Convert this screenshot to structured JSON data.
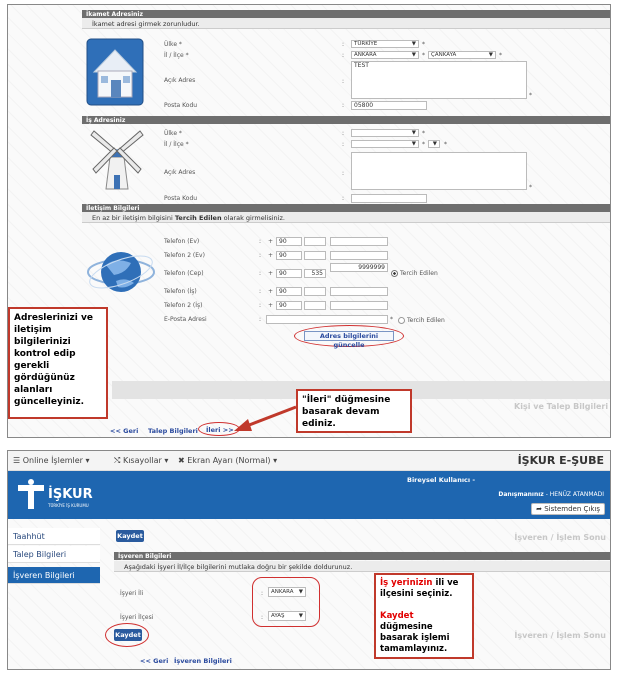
{
  "top": {
    "ikamet": {
      "header": "İkamet Adresiniz",
      "note": "İkamet adresi girmek zorunludur.",
      "labels": {
        "ulke": "Ülke *",
        "il_ilce": "İl / İlçe *",
        "acik_adres": "Açık Adres",
        "posta_kodu": "Posta Kodu"
      },
      "values": {
        "ulke": "TÜRKİYE",
        "il": "ANKARA",
        "ilce": "ÇANKAYA",
        "acik_adres": "TEST",
        "posta_kodu": "05800"
      }
    },
    "is": {
      "header": "İş Adresiniz",
      "labels": {
        "ulke": "Ülke *",
        "il_ilce": "İl / İlçe *",
        "acik_adres": "Açık Adres",
        "posta_kodu": "Posta Kodu"
      }
    },
    "iletisim": {
      "header": "İletişim Bilgileri",
      "note_pre": "En az bir iletişim bilgisini ",
      "note_bold": "Tercih Edilen",
      "note_post": " olarak girmelisiniz.",
      "labels": {
        "tel_ev": "Telefon (Ev)",
        "tel2_ev": "Telefon 2 (Ev)",
        "tel_cep": "Telefon (Cep)",
        "tel_is": "Telefon (İş)",
        "tel2_is": "Telefon 2 (İş)",
        "eposta": "E-Posta Adresi"
      },
      "plus": "+",
      "country_code": "90",
      "cep_prefix": "535",
      "cep_number": "9999999",
      "tercih_edilen": "Tercih Edilen",
      "update_button": "Adres bilgilerini güncelle"
    },
    "callout_left": "Adreslerinizi ve iletişim bilgilerinizi kontrol edip gerekli gördüğünüz alanları güncelleyiniz.",
    "callout_right_quote": "\"İleri\"",
    "callout_right_rest": " düğmesine basarak devam ediniz.",
    "watermark": "Kişi ve Talep Bilgileri",
    "nav": {
      "geri": "<< Geri",
      "current": "Talep Bilgileri",
      "ileri": "İleri >>"
    }
  },
  "bottom": {
    "menu": {
      "online": "Online İşlemler",
      "kisayollar": "Kısayollar",
      "ekran": "Ekran Ayarı (Normal)"
    },
    "app_title": "İŞKUR E-ŞUBE",
    "logo": {
      "name": "İŞKUR",
      "sub": "TÜRKİYE İŞ KURUMU"
    },
    "user": {
      "label": "Bireysel Kullanıcı",
      "dash": "-",
      "danisman_label": "Danışmanınız",
      "danisman_value": "- HENÜZ ATANMADI",
      "logout": "Sistemden Çıkış"
    },
    "sidebar": [
      {
        "label": "Taahhüt"
      },
      {
        "label": "Talep Bilgileri"
      },
      {
        "label": "İşveren Bilgileri"
      }
    ],
    "save_top": "Kaydet",
    "save_bottom": "Kaydet",
    "watermark": "İşveren / İşlem Sonu",
    "section_header": "İşveren Bilgileri",
    "section_note": "Aşağıdaki İşyeri İl/İlçe bilgilerini mutlaka doğru bir şekilde doldurunuz.",
    "labels": {
      "il": "İşyeri İli",
      "ilce": "İşyeri İlçesi"
    },
    "values": {
      "il": "ANKARA",
      "ilce": "AYAŞ"
    },
    "callout": {
      "p1_red": "İş yerinizin",
      "p1_rest": " ili ve ilçesini seçiniz.",
      "p2_red": "Kaydet",
      "p2_rest": " düğmesine basarak işlemi tamamlayınız."
    },
    "nav": {
      "geri": "<< Geri",
      "current": "İşveren Bilgileri"
    }
  }
}
